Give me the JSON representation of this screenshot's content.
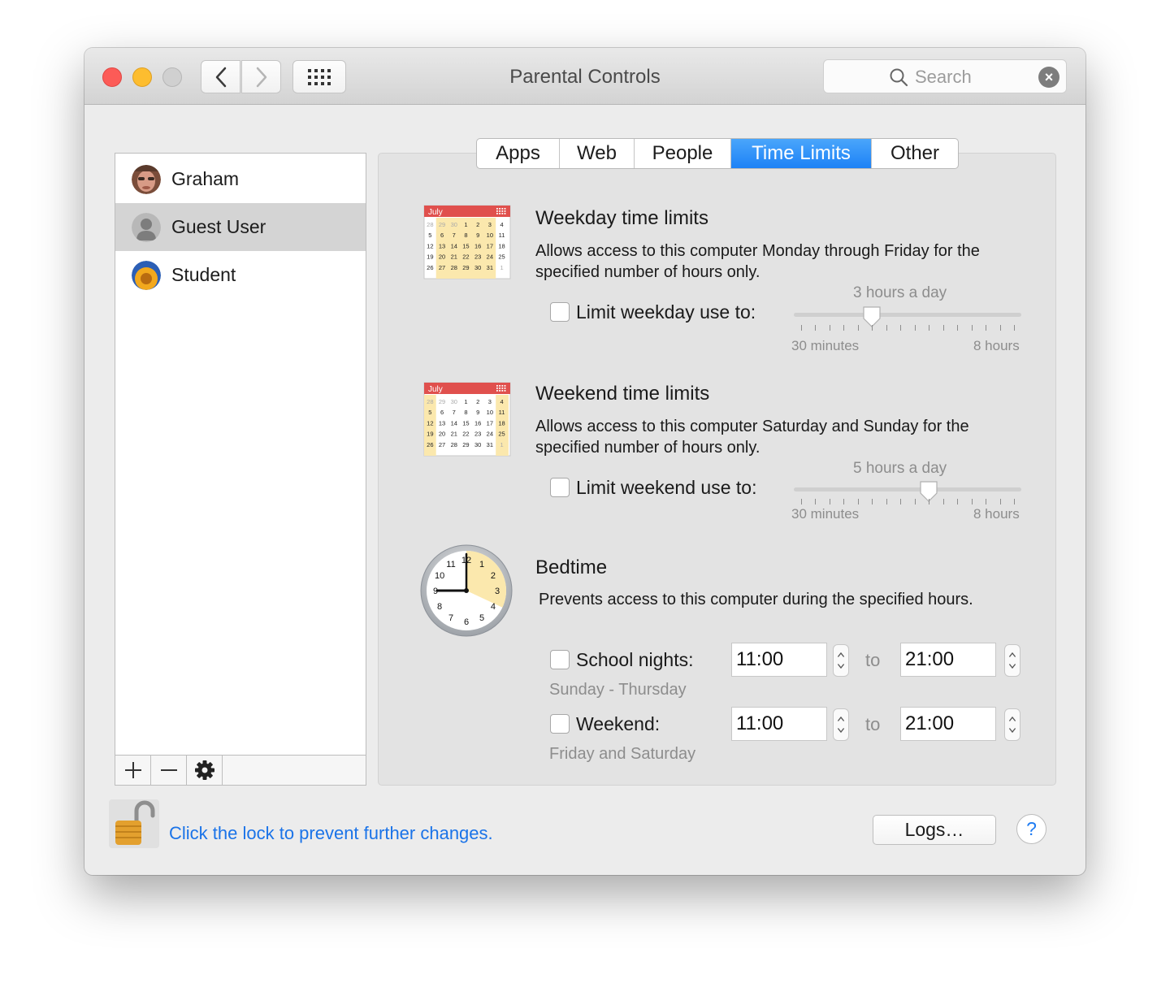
{
  "window": {
    "title": "Parental Controls"
  },
  "search": {
    "placeholder": "Search"
  },
  "users": [
    {
      "name": "Graham"
    },
    {
      "name": "Guest User"
    },
    {
      "name": "Student"
    }
  ],
  "tabs": [
    {
      "label": "Apps"
    },
    {
      "label": "Web"
    },
    {
      "label": "People"
    },
    {
      "label": "Time Limits"
    },
    {
      "label": "Other"
    }
  ],
  "active_tab": "Time Limits",
  "weekday": {
    "title": "Weekday time limits",
    "desc_line1": "Allows access to this computer Monday through Friday for the",
    "desc_line2": "specified number of hours only.",
    "checkbox_label": "Limit weekday use to:",
    "checked": false,
    "value_text": "3 hours a day",
    "min_label": "30 minutes",
    "max_label": "8 hours",
    "hours": 3
  },
  "weekend": {
    "title": "Weekend time limits",
    "desc_line1": "Allows access to this computer Saturday and Sunday for the",
    "desc_line2": "specified number of hours only.",
    "checkbox_label": "Limit weekend use to:",
    "checked": false,
    "value_text": "5 hours a day",
    "min_label": "30 minutes",
    "max_label": "8 hours",
    "hours": 5
  },
  "calendar": {
    "month": "July",
    "days": [
      "28",
      "29",
      "30",
      "1",
      "2",
      "3",
      "4",
      "5",
      "6",
      "7",
      "8",
      "9",
      "10",
      "11",
      "12",
      "13",
      "14",
      "15",
      "16",
      "17",
      "18",
      "19",
      "20",
      "21",
      "22",
      "23",
      "24",
      "25",
      "26",
      "27",
      "28",
      "29",
      "30",
      "31",
      "1"
    ]
  },
  "clock": {
    "numbers": [
      "12",
      "1",
      "2",
      "3",
      "4",
      "5",
      "6",
      "7",
      "8",
      "9",
      "10",
      "11"
    ]
  },
  "bedtime": {
    "title": "Bedtime",
    "desc": "Prevents access to this computer during the specified hours.",
    "school_nights": {
      "label": "School nights:",
      "sub": "Sunday - Thursday",
      "from": "11:00",
      "to": "21:00",
      "checked": false
    },
    "weekend": {
      "label": "Weekend:",
      "sub": "Friday and Saturday",
      "from": "11:00",
      "to": "21:00",
      "checked": false
    },
    "to_label": "to"
  },
  "footer": {
    "lock_text": "Click the lock to prevent further changes.",
    "logs_label": "Logs…",
    "help_label": "?"
  },
  "colors": {
    "accent": "#1d82f6",
    "link": "#1a73e8",
    "close": "#fc5b57",
    "minimize": "#fdbd2f"
  }
}
